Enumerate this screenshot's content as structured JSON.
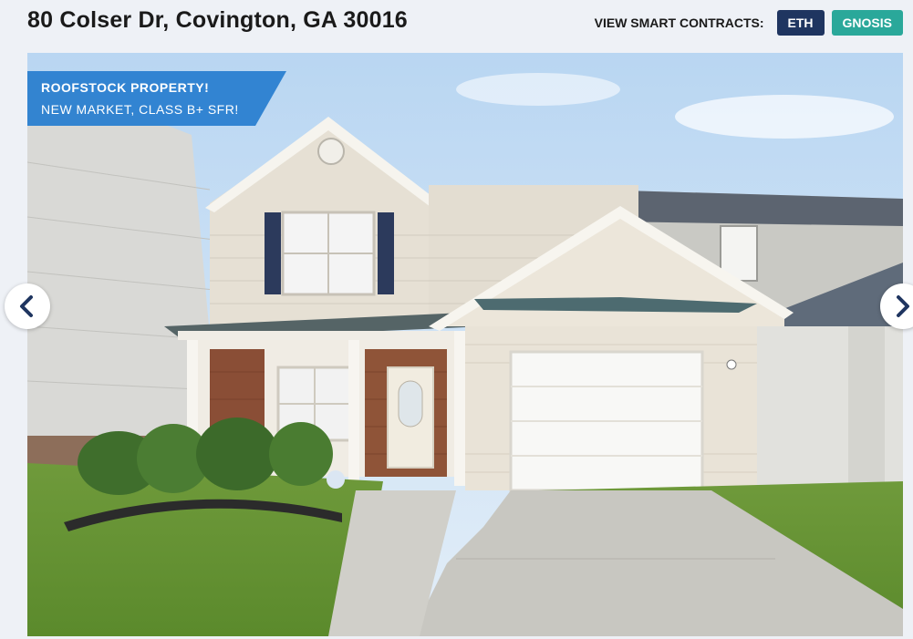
{
  "header": {
    "address": "80 Colser Dr, Covington, GA 30016",
    "contracts_label": "VIEW SMART CONTRACTS:",
    "contracts": [
      {
        "label": "ETH",
        "color": "#1f3560"
      },
      {
        "label": "GNOSIS",
        "color": "#2aa89a"
      }
    ]
  },
  "gallery": {
    "ribbon_title": "ROOFSTOCK PROPERTY!",
    "ribbon_subtitle": "NEW MARKET, CLASS B+ SFR!",
    "ribbon_color": "#2a7fd0",
    "prev_icon": "chevron-left-icon",
    "next_icon": "chevron-right-icon",
    "nav_icon_color": "#1f3560"
  }
}
